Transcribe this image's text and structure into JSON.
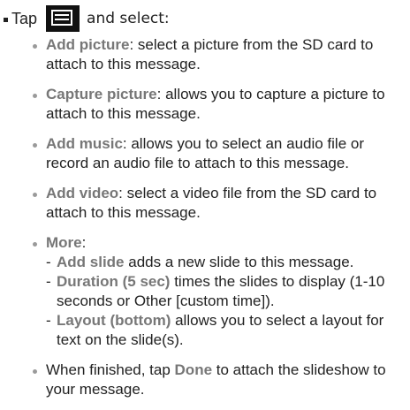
{
  "intro": {
    "prefix": "Tap",
    "menu_key_icon": "menu-key-icon",
    "suffix": "and select:"
  },
  "items": [
    {
      "term": "Add picture",
      "text": ": select a picture from the SD card to attach to this message."
    },
    {
      "term": "Capture picture",
      "text": ": allows you to capture a picture to attach to this message."
    },
    {
      "term": "Add music",
      "text": ": allows you to select an audio file or record an audio file to attach to this message."
    },
    {
      "term": "Add video",
      "text": ": select a video file from the SD card to attach to this message."
    }
  ],
  "more": {
    "term": "More",
    "colon": ":",
    "subitems": [
      {
        "dash": "-",
        "term": "Add slide",
        "text": " adds a new slide to this message."
      },
      {
        "dash": "-",
        "term": "Duration (5 sec)",
        "text": " times the slides to display (1-10 seconds or Other [custom time])."
      },
      {
        "dash": "-",
        "term": "Layout (bottom)",
        "text": " allows you to select a layout for text on the slide(s)."
      }
    ]
  },
  "finish": {
    "before": "When finished, tap ",
    "term": "Done",
    "after": " to attach the slideshow to your message."
  }
}
